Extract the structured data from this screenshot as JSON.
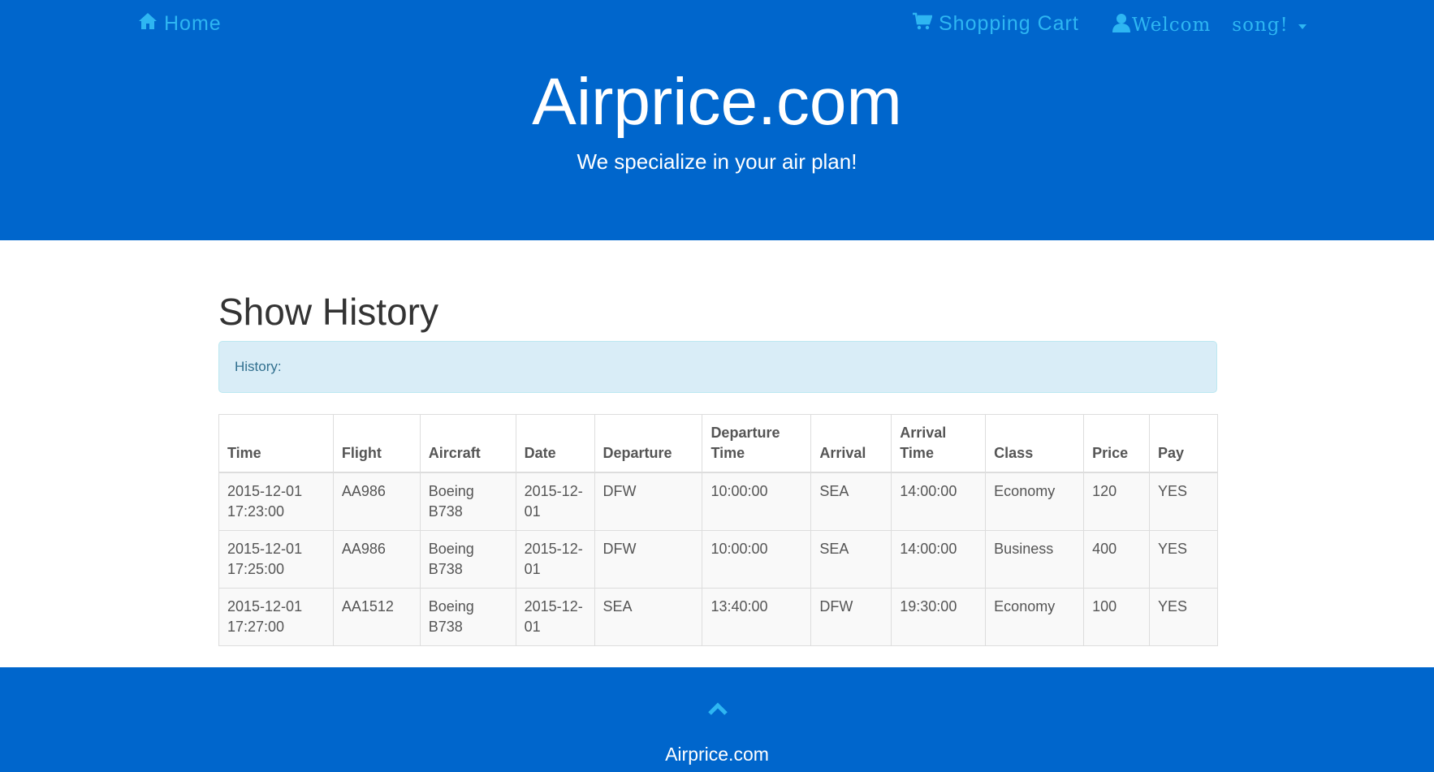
{
  "nav": {
    "home_label": "Home",
    "cart_label": "Shopping Cart",
    "welcome_label": "Welcom",
    "user_name": "song!"
  },
  "header": {
    "title": "Airprice.com",
    "tagline": "We specialize in your air plan!"
  },
  "main": {
    "heading": "Show History",
    "alert_text": "History:"
  },
  "table": {
    "columns": [
      "Time",
      "Flight",
      "Aircraft",
      "Date",
      "Departure",
      "Departure Time",
      "Arrival",
      "Arrival Time",
      "Class",
      "Price",
      "Pay"
    ],
    "rows": [
      [
        "2015-12-01 17:23:00",
        "AA986",
        "Boeing B738",
        "2015-12-01",
        "DFW",
        "10:00:00",
        "SEA",
        "14:00:00",
        "Economy",
        "120",
        "YES"
      ],
      [
        "2015-12-01 17:25:00",
        "AA986",
        "Boeing B738",
        "2015-12-01",
        "DFW",
        "10:00:00",
        "SEA",
        "14:00:00",
        "Business",
        "400",
        "YES"
      ],
      [
        "2015-12-01 17:27:00",
        "AA1512",
        "Boeing B738",
        "2015-12-01",
        "SEA",
        "13:40:00",
        "DFW",
        "19:30:00",
        "Economy",
        "100",
        "YES"
      ]
    ]
  },
  "footer": {
    "brand": "Airprice.com"
  },
  "icons": {
    "home": "home-icon",
    "cart": "shopping-cart-icon",
    "user": "user-icon",
    "caret": "caret-down-icon",
    "up": "chevron-up-icon"
  },
  "colors": {
    "brand_blue": "#0066cc",
    "nav_link": "#2eb6f2",
    "alert_bg": "#d9edf7",
    "alert_text": "#31708f"
  }
}
